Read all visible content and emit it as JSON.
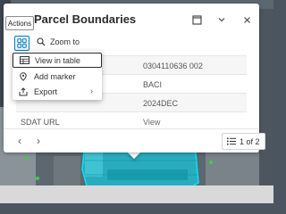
{
  "popup": {
    "title": "Parcel Boundaries",
    "toolbar": {
      "zoom_to_label": "Zoom to"
    },
    "attributes": [
      {
        "key": "",
        "value": "0304110636 002"
      },
      {
        "key": "",
        "value": "BACI"
      },
      {
        "key": "",
        "value": "2024DEC"
      },
      {
        "key": "SDAT URL",
        "value": "View"
      }
    ],
    "footer": {
      "prev": "‹",
      "next": "›",
      "page_text": "1 of 2"
    }
  },
  "actions_menu": {
    "items": [
      {
        "label": "View in table",
        "icon": "table-icon"
      },
      {
        "label": "Add marker",
        "icon": "marker-icon"
      },
      {
        "label": "Export",
        "icon": "export-icon"
      }
    ]
  },
  "tooltip": {
    "text": "Actions"
  },
  "colors": {
    "accent": "#007ac2",
    "parcel_highlight": "#00e5ff"
  }
}
